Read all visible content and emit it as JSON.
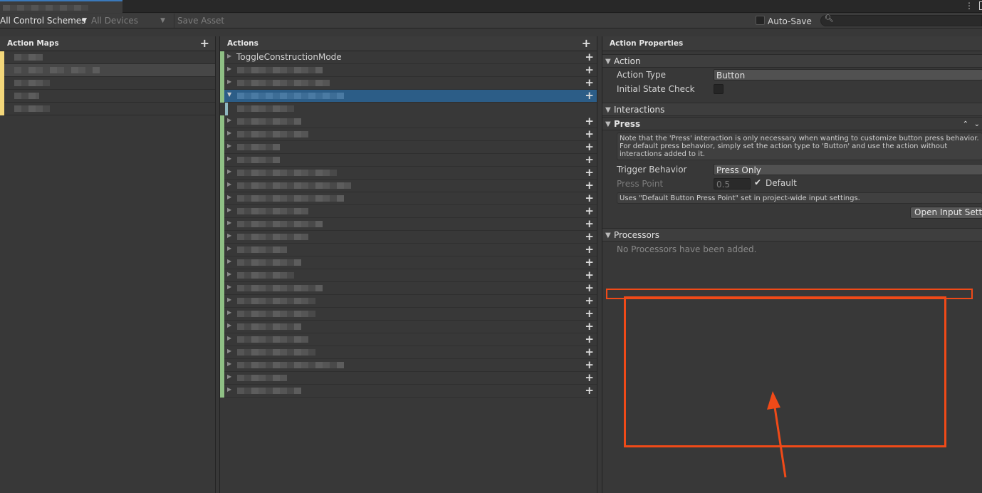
{
  "toolbar": {
    "control_schemes": "All Control Schemes",
    "devices": "All Devices",
    "save_asset": "Save Asset",
    "auto_save": "Auto-Save",
    "search_placeholder": ""
  },
  "panels": {
    "action_maps": {
      "title": "Action Maps"
    },
    "actions": {
      "title": "Actions"
    },
    "properties": {
      "title": "Action Properties"
    }
  },
  "actions": {
    "first_action": "ToggleConstructionMode"
  },
  "properties": {
    "action_section": "Action",
    "action_type_label": "Action Type",
    "action_type_value": "Button",
    "initial_state_label": "Initial State Check",
    "interactions_section": "Interactions",
    "press_header": "Press",
    "press_note": "Note that the 'Press' interaction is only necessary when wanting to customize button press behavior. For default press behavior, simply set the action type to 'Button' and use the action without interactions added to it.",
    "trigger_behavior_label": "Trigger Behavior",
    "trigger_behavior_value": "Press Only",
    "press_point_label": "Press Point",
    "press_point_value": "0.5",
    "default_label": "Default",
    "press_point_note": "Uses \"Default Button Press Point\" set in project-wide input settings.",
    "open_settings_button": "Open Input Settings",
    "processors_section": "Processors",
    "no_processors": "No Processors have been added."
  },
  "colors": {
    "map_marker": "#f3d77a",
    "action_marker": "#8fc085",
    "selection": "#2c5d87",
    "annotation": "#f04a18"
  }
}
